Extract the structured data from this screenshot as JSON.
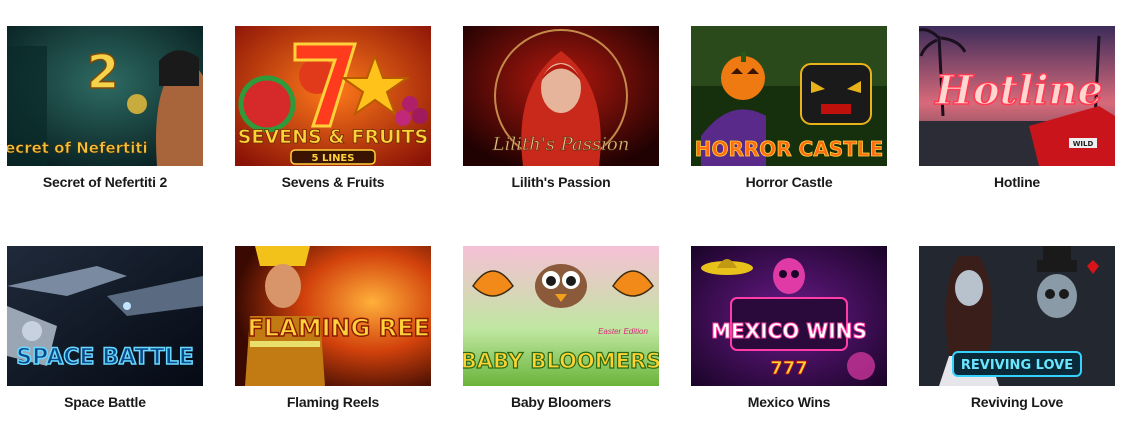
{
  "games": [
    {
      "title": "Secret of Nefertiti 2",
      "art_text": "Secret of Nefertiti",
      "art_badge": "2",
      "colors": {
        "bg": "#0e3b3a",
        "accent": "#f2c23a"
      }
    },
    {
      "title": "Sevens & Fruits",
      "art_text": "SEVENS & FRUITS",
      "art_sub": "5 LINES",
      "colors": {
        "bg": "#c2210c",
        "accent": "#ffd23a"
      }
    },
    {
      "title": "Lilith's Passion",
      "art_text": "Lilith's Passion",
      "colors": {
        "bg": "#3a0605",
        "accent": "#d9a766"
      }
    },
    {
      "title": "Horror Castle",
      "art_text": "HORROR CASTLE",
      "colors": {
        "bg": "#1d3a12",
        "accent": "#f3c21a"
      }
    },
    {
      "title": "Hotline",
      "art_text": "Hotline",
      "art_sub": "WILD",
      "colors": {
        "bg": "#5a3d6b",
        "accent": "#ff5a66"
      }
    },
    {
      "title": "Space Battle",
      "art_text": "SPACE BATTLE",
      "colors": {
        "bg": "#0b1a2e",
        "accent": "#3ec4ff"
      }
    },
    {
      "title": "Flaming Reels",
      "art_text": "FLAMING REELS",
      "colors": {
        "bg": "#6e1a06",
        "accent": "#ffc12e"
      }
    },
    {
      "title": "Baby Bloomers",
      "art_text": "BABY BLOOMERS",
      "art_sub": "Easter Edition",
      "colors": {
        "bg": "#a7dcf2",
        "accent": "#ffd233"
      }
    },
    {
      "title": "Mexico Wins",
      "art_text": "MEXICO WINS",
      "art_sub": "777",
      "colors": {
        "bg": "#2a0a3a",
        "accent": "#ff3da6"
      }
    },
    {
      "title": "Reviving Love",
      "art_text": "REVIVING LOVE",
      "colors": {
        "bg": "#1b1d24",
        "accent": "#34d2ff"
      }
    }
  ]
}
